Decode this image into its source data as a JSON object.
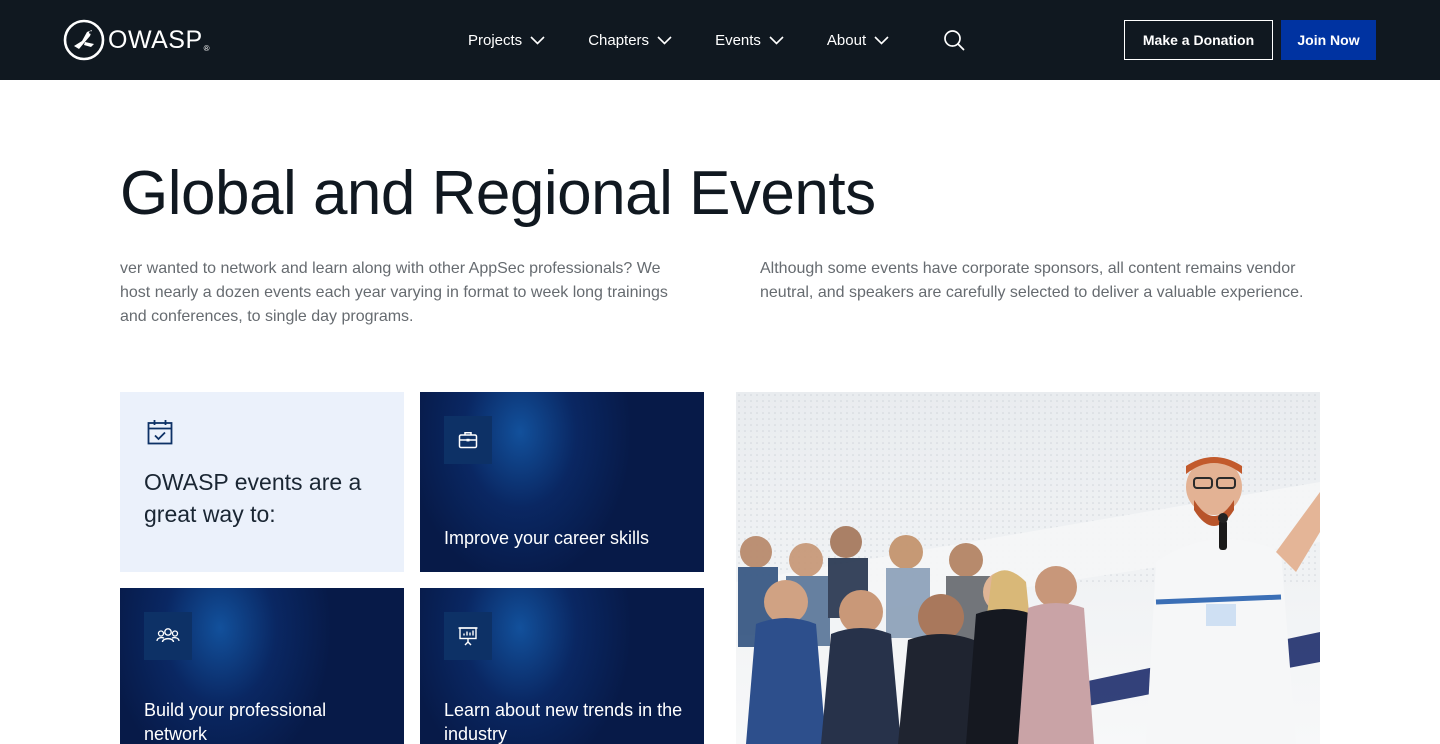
{
  "header": {
    "logo_text": "OWASP",
    "logo_reg": "®",
    "nav": [
      {
        "label": "Projects"
      },
      {
        "label": "Chapters"
      },
      {
        "label": "Events"
      },
      {
        "label": "About"
      }
    ],
    "donate_label": "Make a Donation",
    "join_label": "Join Now"
  },
  "hero": {
    "title": "Global and Regional Events",
    "intro_left": "ver wanted to network and learn along with other AppSec professionals? We host nearly a dozen events each year varying in format to week long trainings and conferences, to single day programs.",
    "intro_right": "Although some events have corporate sponsors, all content remains vendor neutral, and speakers are carefully selected to deliver a valuable experience."
  },
  "cards": {
    "intro_title": "OWASP events are a great way to:",
    "career": "Improve your career skills",
    "network": "Build your professional network",
    "trends": "Learn about new trends in the industry"
  },
  "icons": {
    "calendar": "calendar-check-icon",
    "briefcase": "briefcase-icon",
    "people": "people-icon",
    "presentation": "presentation-board-icon",
    "search": "search-icon",
    "chevron": "chevron-down-icon"
  },
  "colors": {
    "header_bg": "#101820",
    "join_bg": "#0033a1",
    "card_dark": "#071a48",
    "card_light": "#ebf1fb"
  }
}
